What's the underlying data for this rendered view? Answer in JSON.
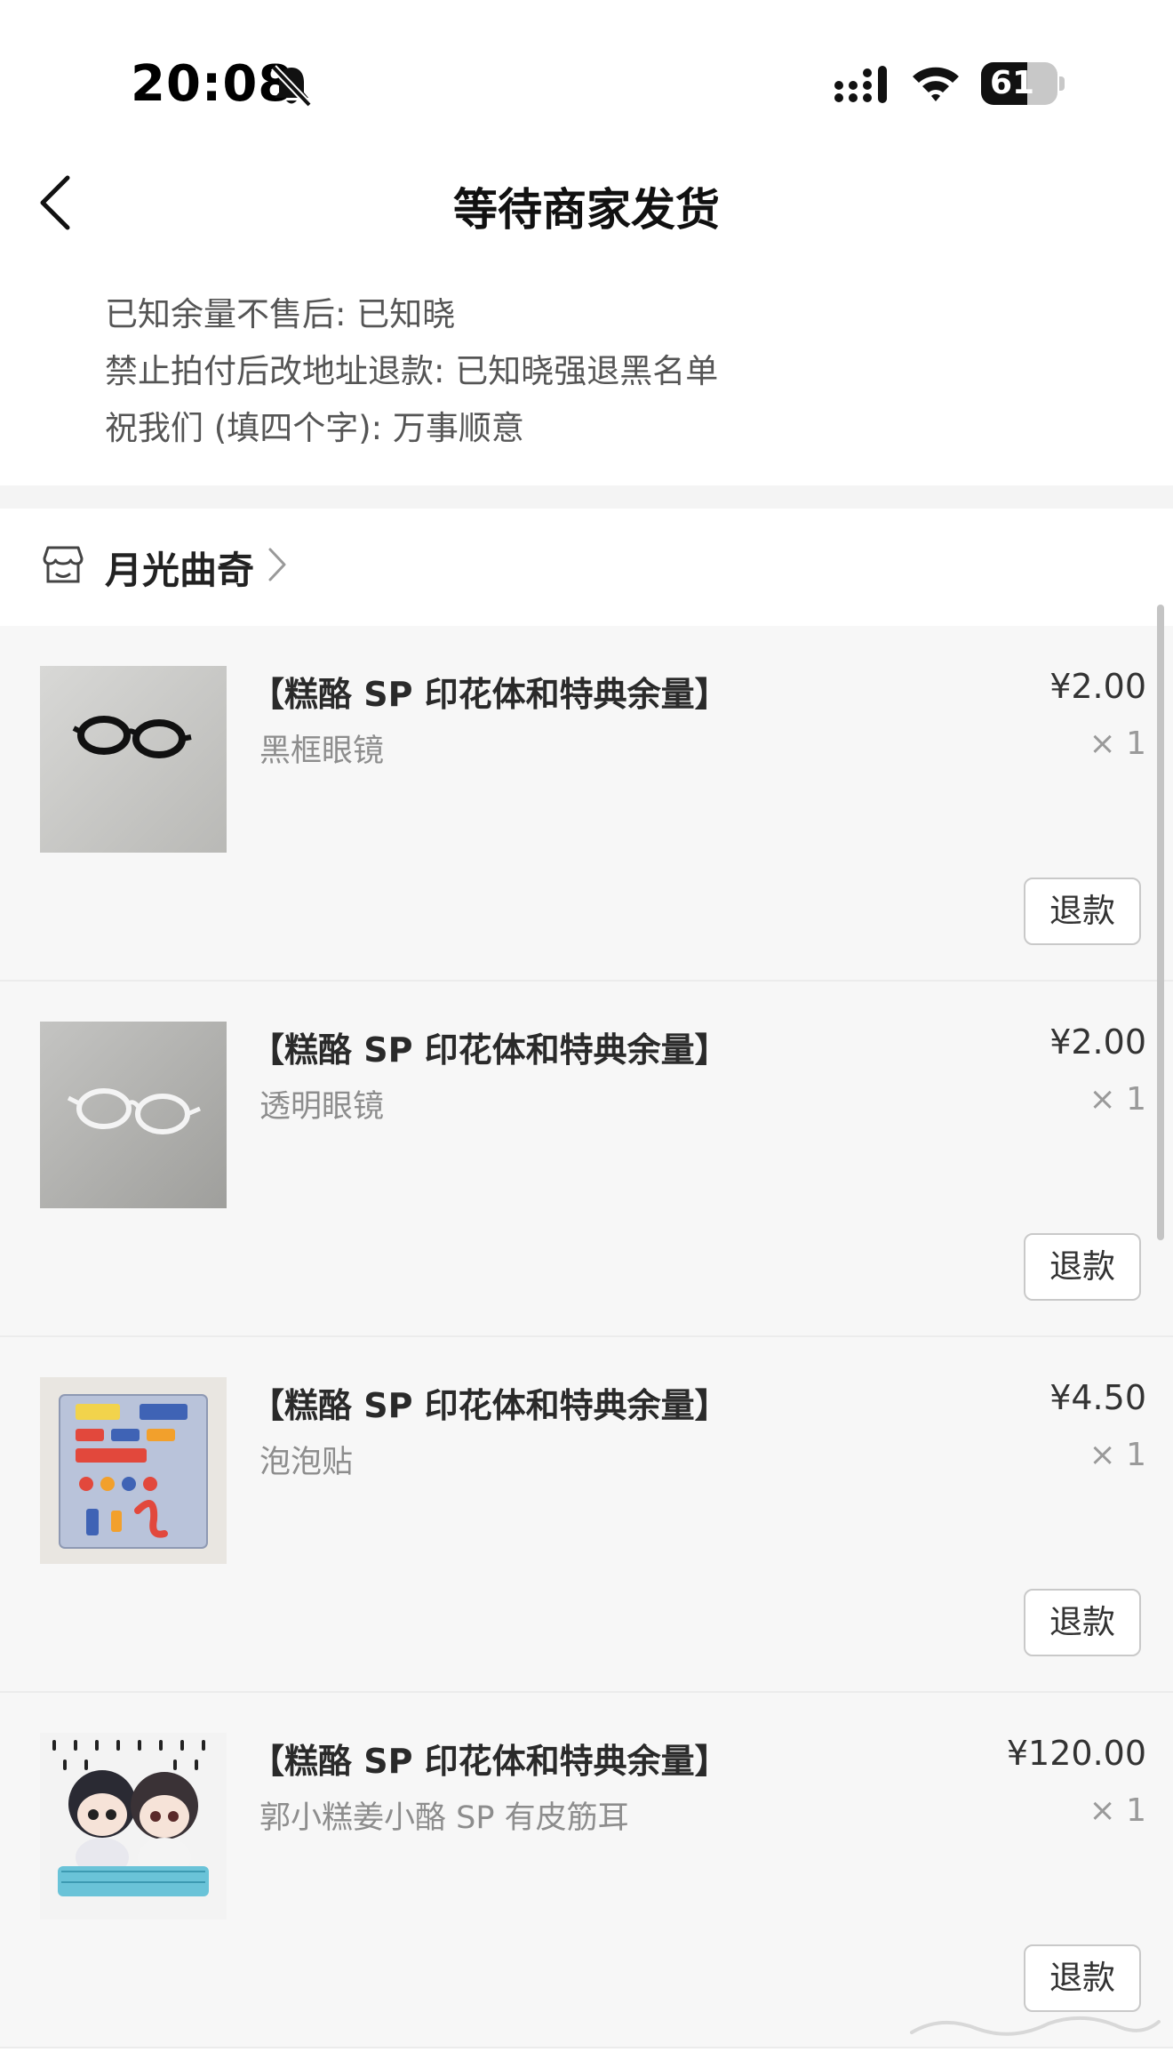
{
  "status_bar": {
    "time": "20:08",
    "battery_percent": "61",
    "battery_level": 0.61,
    "icons": [
      "bell-slash-icon",
      "cellular-signal-icon",
      "wifi-icon",
      "battery-icon"
    ]
  },
  "nav": {
    "back_icon": "chevron-left-icon",
    "title": "等待商家发货"
  },
  "notes": [
    "已知余量不售后: 已知晓",
    "禁止拍付后改地址退款: 已知晓强退黑名单",
    "祝我们 (填四个字): 万事顺意"
  ],
  "shop": {
    "icon": "store-icon",
    "name": "月光曲奇",
    "chevron_icon": "chevron-right-icon"
  },
  "items": [
    {
      "title": "【糕酪 SP 印花体和特典余量】",
      "variant": "黑框眼镜",
      "price": "¥2.00",
      "qty": "× 1",
      "refund_label": "退款",
      "image": "black-glasses-photo"
    },
    {
      "title": "【糕酪 SP 印花体和特典余量】",
      "variant": "透明眼镜",
      "price": "¥2.00",
      "qty": "× 1",
      "refund_label": "退款",
      "image": "clear-glasses-photo"
    },
    {
      "title": "【糕酪 SP 印花体和特典余量】",
      "variant": "泡泡贴",
      "price": "¥4.50",
      "qty": "× 1",
      "refund_label": "退款",
      "image": "sticker-sheet-photo"
    },
    {
      "title": "【糕酪 SP 印花体和特典余量】",
      "variant": "郭小糕姜小酪 SP 有皮筋耳",
      "price": "¥120.00",
      "qty": "× 1",
      "refund_label": "退款",
      "image": "plush-dolls-photo"
    }
  ]
}
